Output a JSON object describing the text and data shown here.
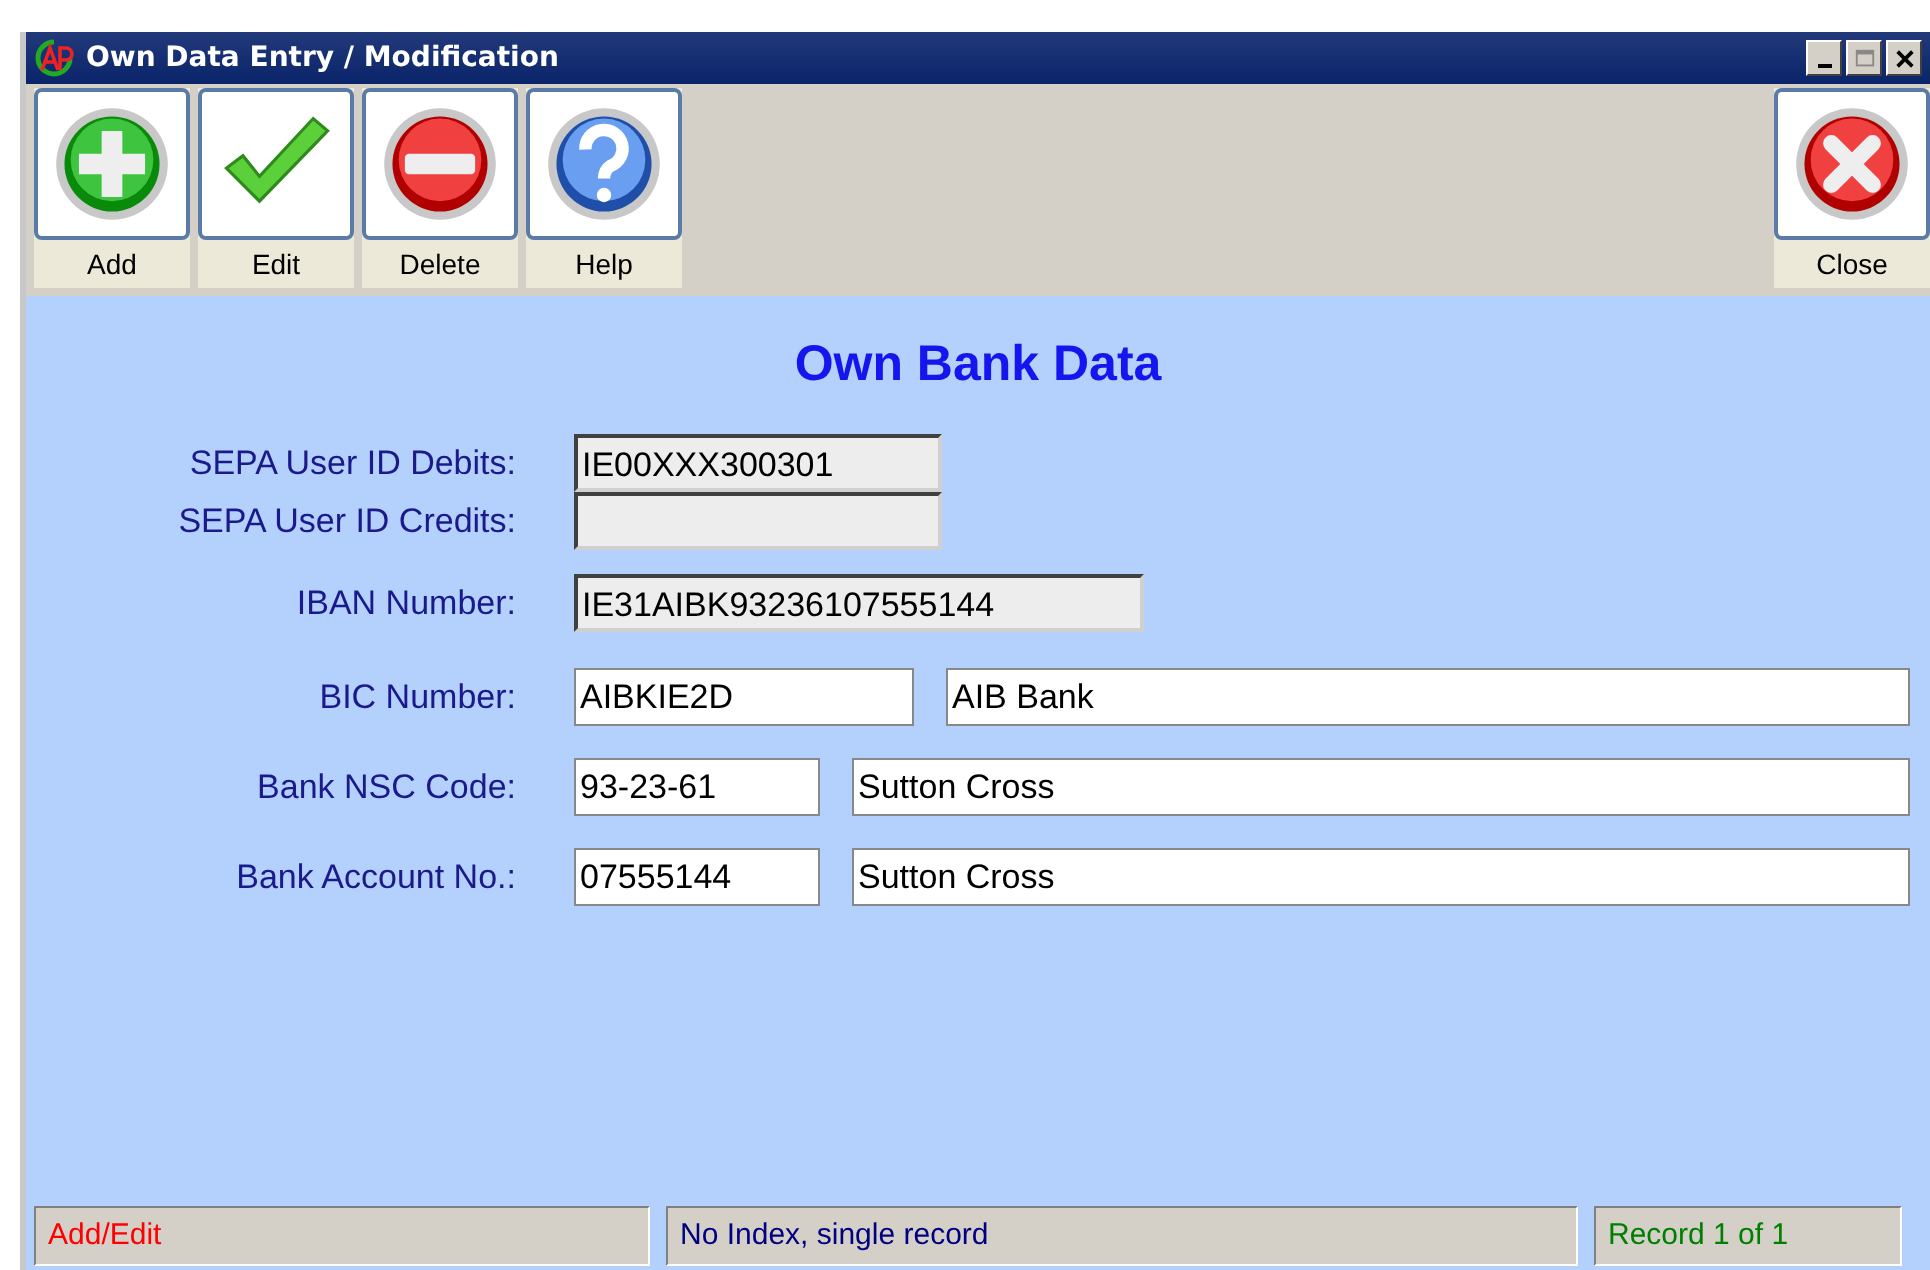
{
  "window": {
    "title": "Own Data Entry / Modification"
  },
  "toolbar": [
    {
      "kind": "add",
      "label": "Add"
    },
    {
      "kind": "edit",
      "label": "Edit"
    },
    {
      "kind": "delete",
      "label": "Delete"
    },
    {
      "kind": "help",
      "label": "Help"
    }
  ],
  "close_button": {
    "kind": "close",
    "label": "Close"
  },
  "form": {
    "heading": "Own Bank Data",
    "rows": [
      {
        "label": "SEPA User ID Debits:",
        "value": "IE00XXX300301",
        "readonly": true
      },
      {
        "label": "SEPA User ID Credits:",
        "readonly": true
      },
      {
        "label": "IBAN Number:",
        "value": "IE31AIBK93236107555144",
        "readonly": true
      },
      {
        "label": "BIC Number:",
        "value": "AIBKIE2D",
        "readonly": false,
        "name": "AIB Bank"
      },
      {
        "label": "Bank NSC Code:",
        "value": "93-23-61",
        "readonly": false,
        "name": "Sutton Cross"
      },
      {
        "label": "Bank Account No.:",
        "value": "07555144",
        "readonly": false,
        "name": "Sutton Cross"
      }
    ]
  },
  "status_bar": [
    {
      "text": "Add/Edit",
      "color": "#ff0000"
    },
    {
      "text": "No Index, single record",
      "color": "#000080"
    },
    {
      "text": "Record 1 of 1",
      "color": "#008000"
    }
  ]
}
